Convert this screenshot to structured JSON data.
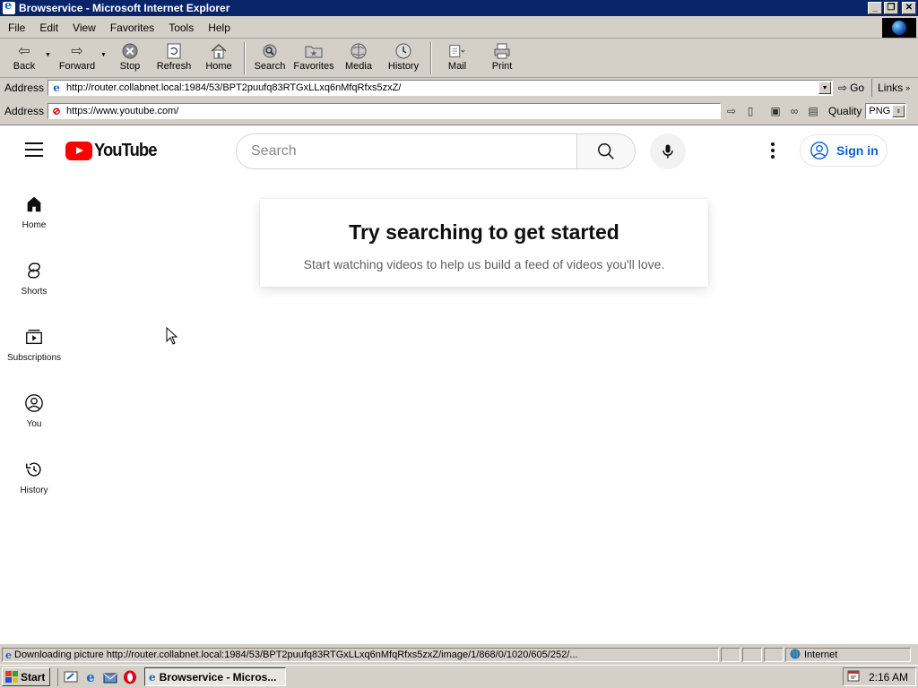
{
  "window": {
    "title": "Browservice - Microsoft Internet Explorer",
    "buttons": {
      "minimize": "_",
      "maximize": "❐",
      "close": "✕"
    }
  },
  "menu": [
    "File",
    "Edit",
    "View",
    "Favorites",
    "Tools",
    "Help"
  ],
  "toolbar": {
    "back": "Back",
    "forward": "Forward",
    "stop": "Stop",
    "refresh": "Refresh",
    "home": "Home",
    "search": "Search",
    "favorites": "Favorites",
    "media": "Media",
    "history": "History",
    "mail": "Mail",
    "print": "Print"
  },
  "ie_address": {
    "label": "Address",
    "url": "http://router.collabnet.local:1984/53/BPT2puufq83RTGxLLxq6nMfqRfxs5zxZ/",
    "go": "Go",
    "links": "Links"
  },
  "browservice_bar": {
    "label": "Address",
    "url": "https://www.youtube.com/",
    "quality_label": "Quality",
    "quality_value": "PNG"
  },
  "youtube": {
    "logo_text": "YouTube",
    "search_placeholder": "Search",
    "sign_in": "Sign in",
    "guide": [
      {
        "label": "Home",
        "icon": "home-icon"
      },
      {
        "label": "Shorts",
        "icon": "shorts-icon"
      },
      {
        "label": "Subscriptions",
        "icon": "subscriptions-icon"
      },
      {
        "label": "You",
        "icon": "you-icon"
      },
      {
        "label": "History",
        "icon": "history-icon"
      }
    ],
    "promo_title": "Try searching to get started",
    "promo_subtitle": "Start watching videos to help us build a feed of videos you'll love."
  },
  "status": {
    "text": "Downloading picture http://router.collabnet.local:1984/53/BPT2puufq83RTGxLLxq6nMfqRfxs5zxZ/image/1/868/0/1020/605/252/...",
    "zone": "Internet"
  },
  "taskbar": {
    "start": "Start",
    "task_label": "Browservice - Micros...",
    "clock": "2:16 AM"
  },
  "colors": {
    "titlebar": "#0a246a",
    "youtube_red": "#ff0000",
    "signin_blue": "#065fd4"
  }
}
